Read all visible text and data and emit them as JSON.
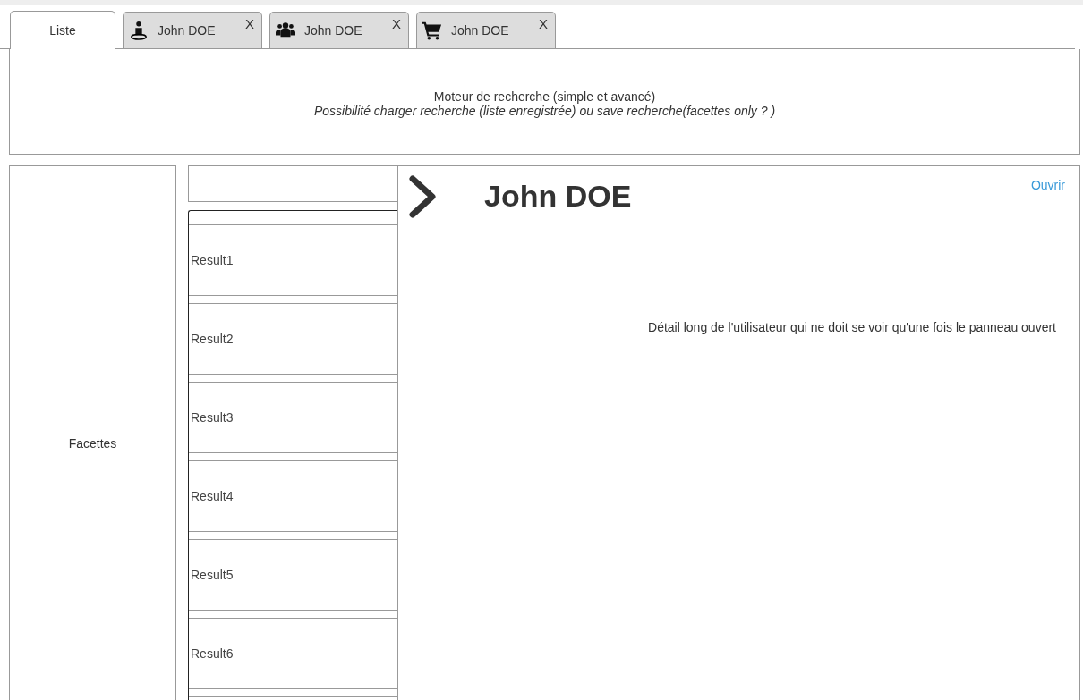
{
  "tabs": [
    {
      "label": "Liste",
      "selected": true
    },
    {
      "label": "John DOE",
      "selected": false,
      "close": "X",
      "kind": "person"
    },
    {
      "label": "John DOE",
      "selected": false,
      "close": "X",
      "kind": "group"
    },
    {
      "label": "John DOE",
      "selected": false,
      "close": "X",
      "kind": "cart"
    }
  ],
  "search_engine": {
    "title": "Moteur de recherche (simple et avancé)",
    "note": "Possibilité charger recherche (liste enregistrée) ou save recherche(facettes only ? )"
  },
  "facets": {
    "label": "Facettes"
  },
  "results": [
    "Result1",
    "Result2",
    "Result3",
    "Result4",
    "Result5",
    "Result6"
  ],
  "detail": {
    "name": "John DOE",
    "open_link": "Ouvrir",
    "description": "Détail long de l'utilisateur qui ne doit se voir qu'une fois le panneau ouvert"
  }
}
